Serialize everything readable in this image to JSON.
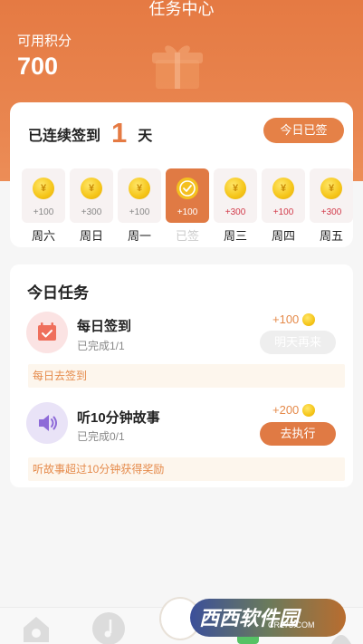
{
  "header": {
    "title": "任务中心",
    "points_label": "可用积分",
    "points_value": "700"
  },
  "signin": {
    "streak_prefix": "已连续签到",
    "streak_count": "1",
    "streak_suffix": "天",
    "signed_button": "今日已签",
    "days": [
      {
        "label": "周六",
        "points": "+100",
        "state": "normal",
        "points_color": "gray"
      },
      {
        "label": "周日",
        "points": "+300",
        "state": "normal",
        "points_color": "gray"
      },
      {
        "label": "周一",
        "points": "+100",
        "state": "normal",
        "points_color": "gray"
      },
      {
        "label": "已签",
        "points": "+100",
        "state": "signed",
        "points_color": "white"
      },
      {
        "label": "周三",
        "points": "+300",
        "state": "normal",
        "points_color": "red"
      },
      {
        "label": "周四",
        "points": "+100",
        "state": "normal",
        "points_color": "red"
      },
      {
        "label": "周五",
        "points": "+300",
        "state": "normal",
        "points_color": "red"
      }
    ]
  },
  "tasks": {
    "title": "今日任务",
    "items": [
      {
        "name": "每日签到",
        "progress": "已完成1/1",
        "reward": "+100",
        "button": "明天再来",
        "hint": "每日去签到",
        "icon": "calendar-icon"
      },
      {
        "name": "听10分钟故事",
        "progress": "已完成0/1",
        "reward": "+200",
        "button": "去执行",
        "hint": "听故事超过10分钟获得奖励",
        "icon": "speaker-icon"
      }
    ]
  },
  "watermark": {
    "main": "西西软件园",
    "sub": "CR173.COM"
  },
  "colors": {
    "accent": "#e57a43",
    "coin": "#f5c518",
    "red_points": "#d23a4a"
  }
}
